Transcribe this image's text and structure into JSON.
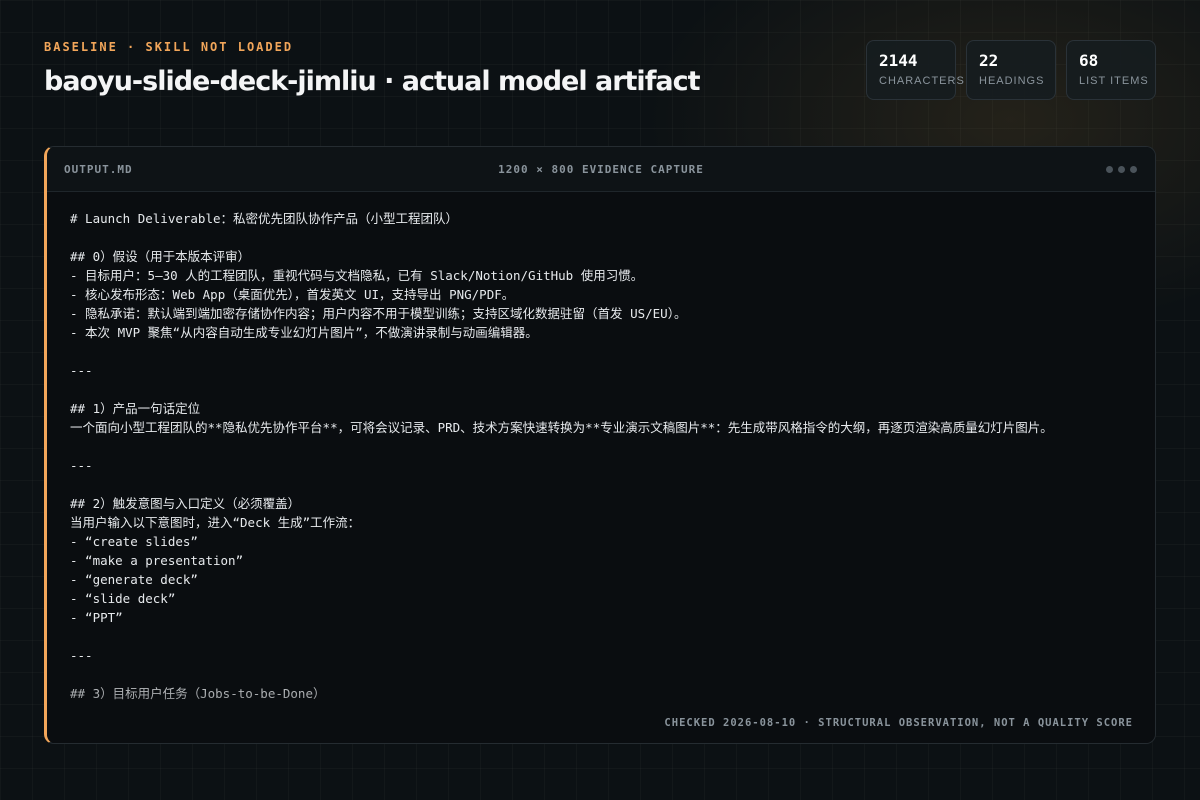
{
  "header": {
    "eyebrow": "BASELINE · SKILL NOT LOADED",
    "title": "baoyu-slide-deck-jimliu · actual model artifact"
  },
  "stats": [
    {
      "value": "2144",
      "label": "CHARACTERS"
    },
    {
      "value": "22",
      "label": "HEADINGS"
    },
    {
      "value": "68",
      "label": "LIST ITEMS"
    }
  ],
  "panel": {
    "file_name": "OUTPUT.MD",
    "capture_label": "1200 × 800 EVIDENCE CAPTURE",
    "footer_note": "CHECKED 2026-08-10 · STRUCTURAL OBSERVATION, NOT A QUALITY SCORE",
    "content": "# Launch Deliverable：私密优先团队协作产品（小型工程团队）\n\n## 0）假设（用于本版本评审）\n- 目标用户：5–30 人的工程团队，重视代码与文档隐私，已有 Slack/Notion/GitHub 使用习惯。\n- 核心发布形态：Web App（桌面优先），首发英文 UI，支持导出 PNG/PDF。\n- 隐私承诺：默认端到端加密存储协作内容；用户内容不用于模型训练；支持区域化数据驻留（首发 US/EU）。\n- 本次 MVP 聚焦“从内容自动生成专业幻灯片图片”，不做演讲录制与动画编辑器。\n\n---\n\n## 1）产品一句话定位\n一个面向小型工程团队的**隐私优先协作平台**，可将会议记录、PRD、技术方案快速转换为**专业演示文稿图片**：先生成带风格指令的大纲，再逐页渲染高质量幻灯片图片。\n\n---\n\n## 2）触发意图与入口定义（必须覆盖）\n当用户输入以下意图时，进入“Deck 生成”工作流：\n- “create slides”\n- “make a presentation”\n- “generate deck”\n- “slide deck”\n- “PPT”\n\n---\n\n## 3）目标用户任务（Jobs-to-be-Done）"
  },
  "colors": {
    "accent": "#f2a65a",
    "background": "#0c1114",
    "muted_text": "#8a949c"
  }
}
